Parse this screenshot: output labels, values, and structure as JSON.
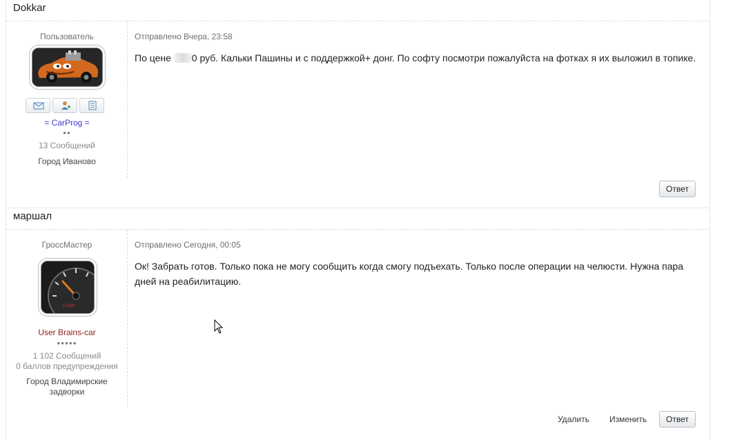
{
  "posts": [
    {
      "author": "Dokkar",
      "rank_title": "Пользователь",
      "group_name": "= CarProg =",
      "pips": "●●",
      "posts_count": "13 Сообщений",
      "city": "Город Иваново",
      "sent": "Отправлено Вчера, 23:58",
      "body_before": "По цене ",
      "body_after": "0 руб. Кальки Пашины и с поддержкой+ донг. По софту посмотри пожалуйста на фотках я их выложил в топике.",
      "reply_label": "Ответ"
    },
    {
      "author": "маршал",
      "rank_title": "ГроссМастер",
      "group_name": "User Brains-car",
      "pips": "●●●●●",
      "posts_count": "1 102 Сообщений",
      "warnings": "0 баллов предупреждения",
      "city": "Город Владимирские задворки",
      "sent": "Отправлено Сегодня, 00:05",
      "body": "Ок! Забрать готов. Только пока не могу сообщить когда смогу подъехать. Только после операции на челюсти. Нужна пара дней на реабилитацию.",
      "delete_label": "Удалить",
      "edit_label": "Изменить",
      "reply_label": "Ответ"
    }
  ],
  "icons": [
    "mail-icon",
    "add-friend-icon",
    "view-posts-icon"
  ]
}
